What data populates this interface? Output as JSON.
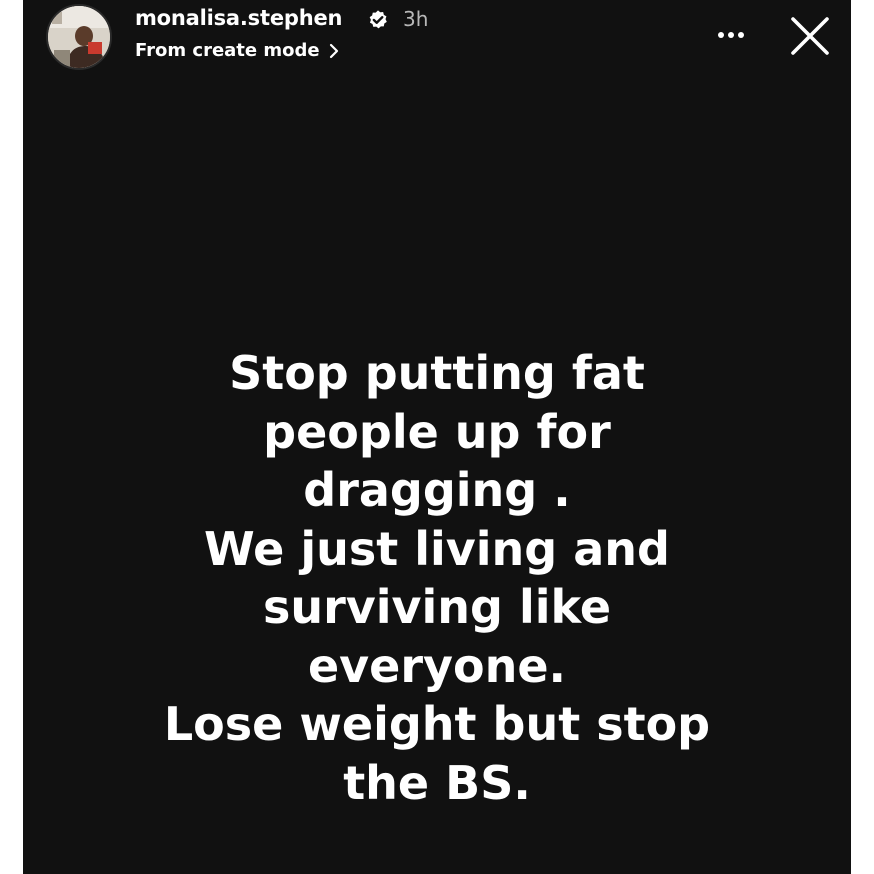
{
  "header": {
    "username": "monalisa.stephen",
    "verified_icon": "verified-badge-icon",
    "time_ago": "3h",
    "subtitle": "From create mode",
    "subtitle_icon": "chevron-right-icon",
    "more_icon": "more-horizontal-icon",
    "close_icon": "close-icon"
  },
  "story": {
    "background_color": "#111111",
    "text_color": "#ffffff",
    "lines": [
      "Stop putting fat",
      "people up for",
      "dragging .",
      "We just living and",
      "surviving like",
      "everyone.",
      "Lose weight but stop",
      "the BS."
    ]
  }
}
